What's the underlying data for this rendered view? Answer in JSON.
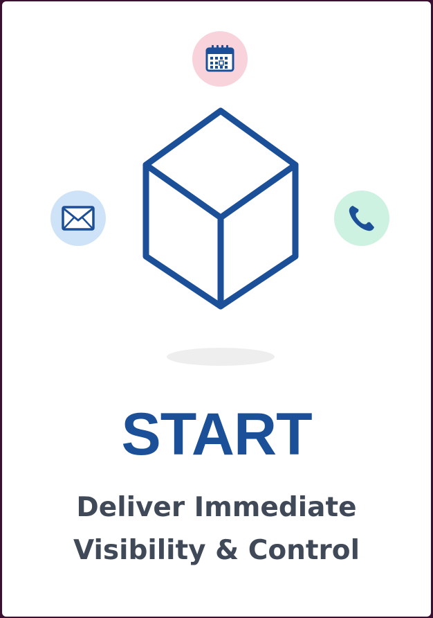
{
  "headline": "START",
  "subheadline": {
    "line1": "Deliver Immediate",
    "line2": "Visibility & Control"
  },
  "icons": {
    "top": "calendar-icon",
    "left": "envelope-icon",
    "right": "phone-icon",
    "center": "cube-icon"
  },
  "colors": {
    "brand_blue": "#1b4f98",
    "text_gray": "#3f4958",
    "calendar_bg": "#f9d3db",
    "mail_bg": "#cfe3f8",
    "phone_bg": "#cdf2e1"
  }
}
